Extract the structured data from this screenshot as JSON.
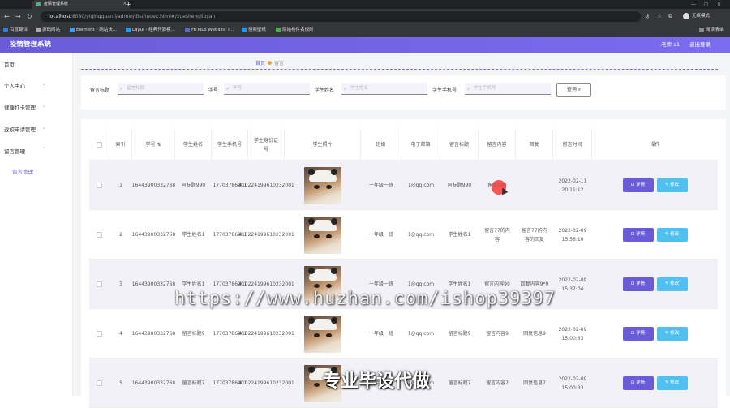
{
  "browser": {
    "tab_title": "疫情管理系统",
    "url_host": "localhost",
    "url_path": ":8080/yiqingguanli/admin/dist/index.html#/xueshengliuyan",
    "profile_label": "无痕模式",
    "bookmarks": [
      "百度翻译",
      "源码网站",
      "Element - 网站快...",
      "Layui - 经典开源模...",
      "HTML5 Website T...",
      "搜索壁纸",
      "原始构件名规则"
    ],
    "bookmarks_right": "阅读清单"
  },
  "header": {
    "title": "疫情管理系统",
    "user": "老师 a1",
    "logout": "退出登录"
  },
  "sidebar": {
    "items": [
      {
        "label": "首页"
      },
      {
        "label": "个人中心"
      },
      {
        "label": "健康打卡管理"
      },
      {
        "label": "返校申请管理"
      },
      {
        "label": "留言管理"
      },
      {
        "label": "留言管理"
      }
    ]
  },
  "breadcrumb": {
    "home": "首页",
    "current": "留言"
  },
  "search": {
    "fields": [
      {
        "label": "留言标题",
        "placeholder": "留言标题"
      },
      {
        "label": "学号",
        "placeholder": "学号"
      },
      {
        "label": "学生姓名",
        "placeholder": "学生姓名"
      },
      {
        "label": "学生手机号",
        "placeholder": "学生手机号"
      }
    ],
    "button": "查询"
  },
  "table": {
    "headers": [
      "索引",
      "学号",
      "学生姓名",
      "学生手机号",
      "学生身份证号",
      "学生照片",
      "班级",
      "电子邮箱",
      "留言标题",
      "留言内容",
      "回复",
      "留言时间",
      "操作"
    ],
    "rows": [
      {
        "index": "1",
        "xuehao": "16443900332768",
        "name": "阿标题999",
        "phone": "17703786901",
        "idcard": "410224199610232001",
        "banji": "一年级一班",
        "email": "1@qq.com",
        "title": "阿标题999",
        "content": "留言999",
        "reply": "",
        "time": "2022-02-11 20:11:12"
      },
      {
        "index": "2",
        "xuehao": "16443900332768",
        "name": "学生姓名1",
        "phone": "17703786901",
        "idcard": "410224199610232001",
        "banji": "一年级一班",
        "email": "1@qq.com",
        "title": "学生姓名1",
        "content": "留言77的内容",
        "reply": "留言77的内容的回复",
        "time": "2022-02-09 15:56:10"
      },
      {
        "index": "3",
        "xuehao": "16443900332768",
        "name": "学生姓名1",
        "phone": "17703786901",
        "idcard": "410224199610232001",
        "banji": "一年级一班",
        "email": "1@qq.com",
        "title": "学生姓名1",
        "content": "留言内容99",
        "reply": "回复内容9*9",
        "time": "2022-02-09 15:37:04"
      },
      {
        "index": "4",
        "xuehao": "16443900332768",
        "name": "留言标题9",
        "phone": "17703786901",
        "idcard": "410224199610232001",
        "banji": "一年级一班",
        "email": "1@qq.com",
        "title": "留言标题9",
        "content": "留言内容9",
        "reply": "回复信息9",
        "time": "2022-02-09 15:00:33"
      },
      {
        "index": "5",
        "xuehao": "16443900332768",
        "name": "留言标题7",
        "phone": "17703786901",
        "idcard": "410224199610232001",
        "banji": "一年级一班",
        "email": "1@qq.com",
        "title": "留言标题7",
        "content": "留言内容7",
        "reply": "回复信息7",
        "time": "2022-02-09 15:00:33"
      }
    ],
    "detail_label": "详情",
    "edit_label": "修改"
  },
  "watermark": "https://www.huzhan.com/ishop39397",
  "watermark2": "专业毕设代做"
}
